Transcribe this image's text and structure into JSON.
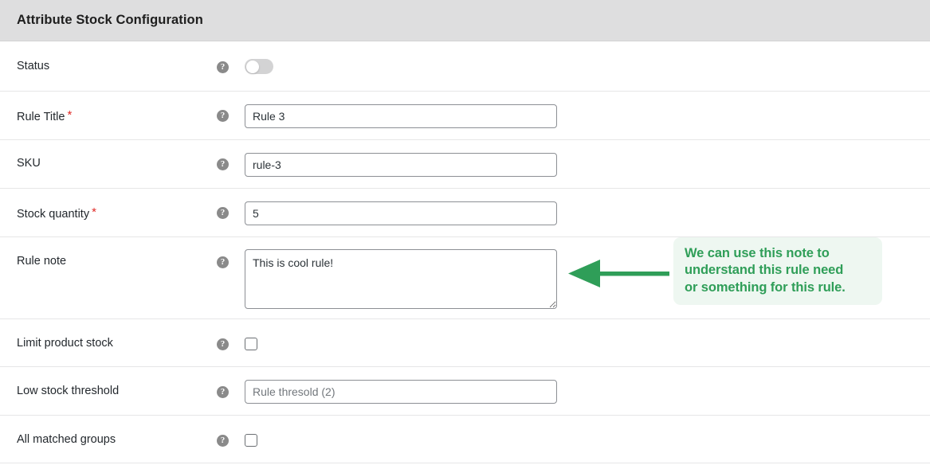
{
  "panel": {
    "title": "Attribute Stock Configuration"
  },
  "icons": {
    "help": "?",
    "help_name": "help-icon"
  },
  "rows": [
    {
      "key": "status",
      "label": "Status",
      "control": "toggle",
      "value": "off"
    },
    {
      "key": "rule_title",
      "label": "Rule Title",
      "required": true,
      "required_marker": "*",
      "control": "text",
      "value": "Rule 3",
      "placeholder": ""
    },
    {
      "key": "sku",
      "label": "SKU",
      "required": false,
      "control": "text",
      "value": "rule-3",
      "placeholder": ""
    },
    {
      "key": "stock_quantity",
      "label": "Stock quantity",
      "required": true,
      "required_marker": "*",
      "control": "text",
      "value": "5",
      "placeholder": ""
    },
    {
      "key": "rule_note",
      "label": "Rule note",
      "required": false,
      "control": "textarea",
      "value": "This is cool rule!",
      "placeholder": ""
    },
    {
      "key": "limit_product_stock",
      "label": "Limit product stock",
      "required": false,
      "control": "checkbox",
      "checked": false
    },
    {
      "key": "low_stock_threshold",
      "label": "Low stock threshold",
      "required": false,
      "control": "text",
      "value": "",
      "placeholder": "Rule thresold (2)"
    },
    {
      "key": "all_matched_groups",
      "label": "All matched groups",
      "required": false,
      "control": "checkbox",
      "checked": false
    }
  ],
  "annotation": {
    "arrow_direction": "left",
    "lines": [
      "We can use this note to",
      "understand this rule need",
      "or something for this rule."
    ],
    "text_color": "#2f9e58",
    "background_color": "#eef7f1",
    "arrow_color": "#2f9e58"
  },
  "colors": {
    "header_bg": "#dededf",
    "row_border": "#e6e6e7",
    "label_text": "#23282d",
    "required_red": "#e02b27",
    "input_border": "#8c8f94",
    "toggle_track": "#d3d3d4",
    "help_icon_bg": "#8a8a8a"
  }
}
